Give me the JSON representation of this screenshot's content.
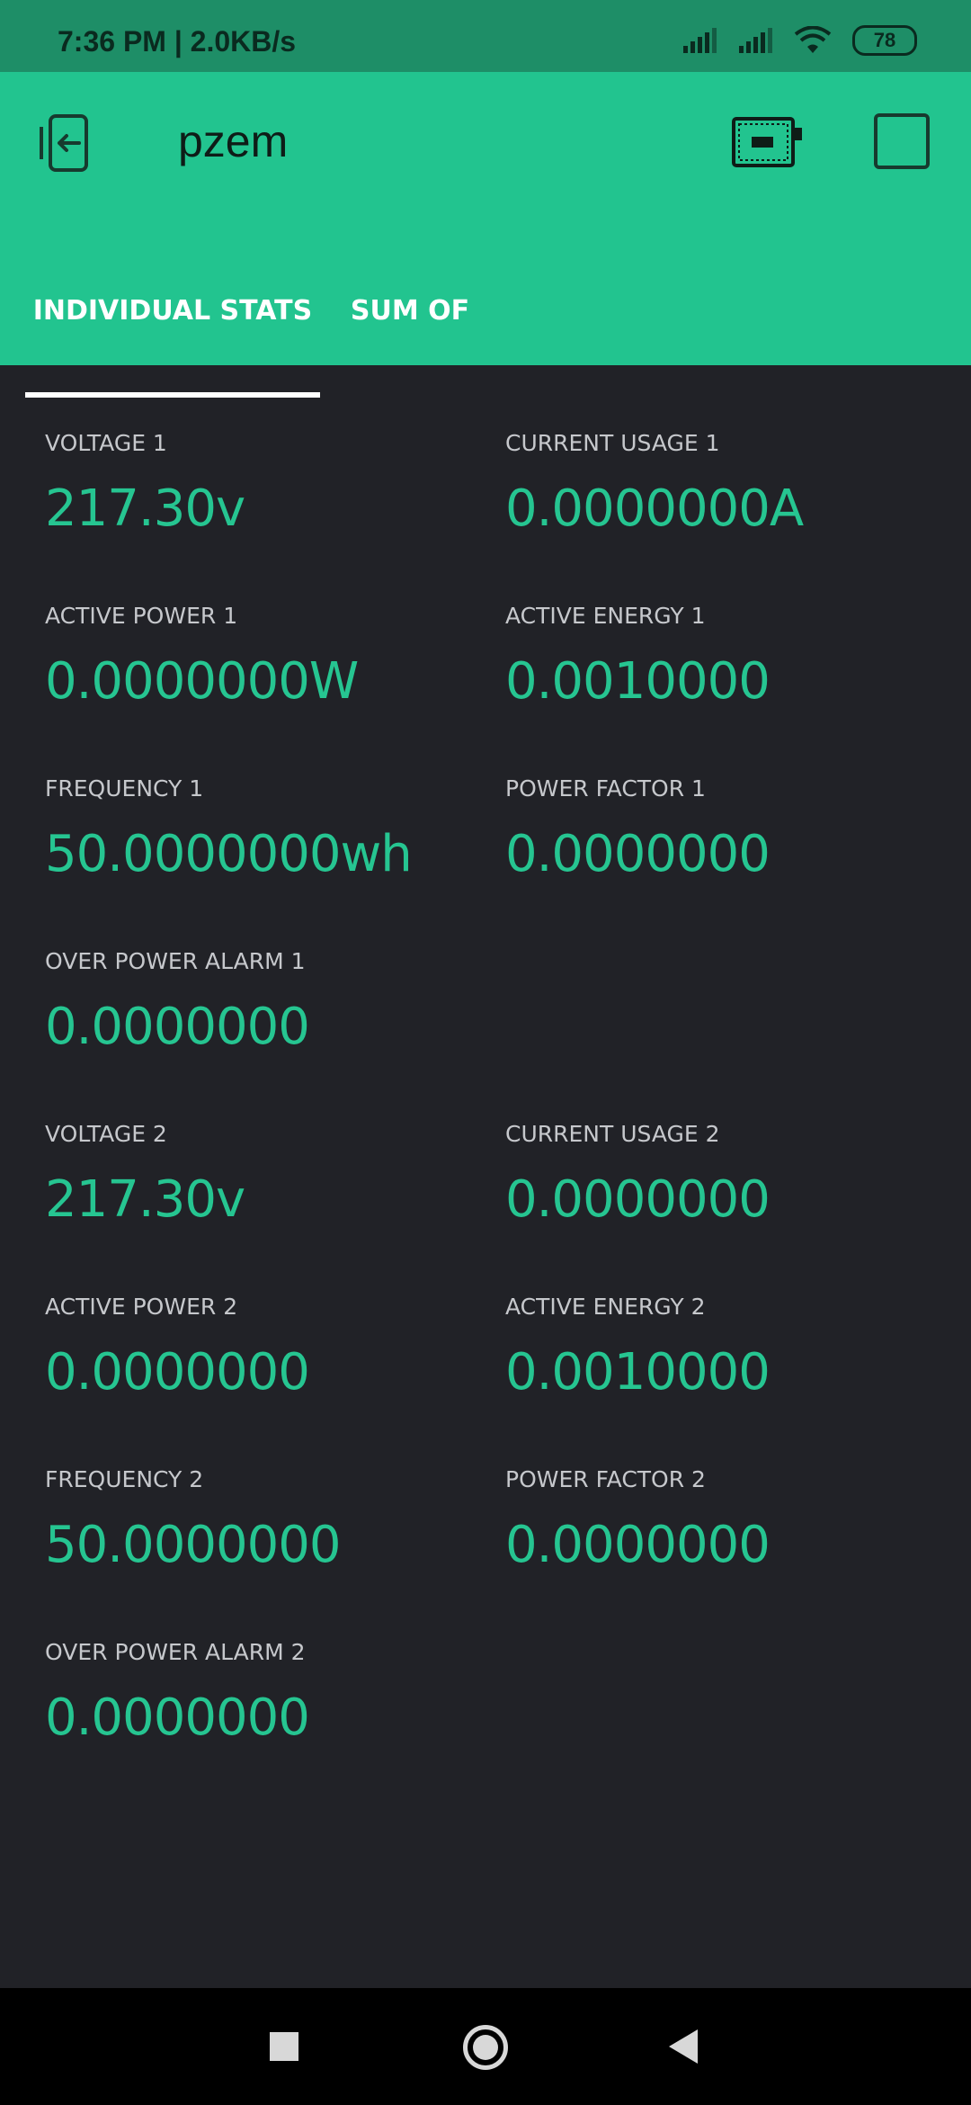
{
  "status_bar": {
    "time": "7:36 PM | 2.0KB/s",
    "battery": "78",
    "icons": [
      "signal-icon",
      "signal-icon",
      "wifi-icon",
      "battery-icon"
    ]
  },
  "app_bar": {
    "title": "pzem",
    "background_color": "#22c48f",
    "icons": [
      "back-icon",
      "device-icon",
      "square-icon"
    ]
  },
  "tabs": [
    {
      "label": "INDIVIDUAL STATS",
      "selected": true
    },
    {
      "label": "SUM OF",
      "selected": false
    }
  ],
  "stats": [
    {
      "label": "VOLTAGE 1",
      "value": "217.30v"
    },
    {
      "label": "CURRENT USAGE 1",
      "value": "0.0000000A"
    },
    {
      "label": "ACTIVE POWER 1",
      "value": "0.0000000W"
    },
    {
      "label": "ACTIVE ENERGY 1",
      "value": "0.0010000"
    },
    {
      "label": "FREQUENCY 1",
      "value": "50.0000000wh"
    },
    {
      "label": "POWER FACTOR 1",
      "value": "0.0000000"
    },
    {
      "label": "OVER POWER ALARM 1",
      "value": "0.0000000"
    },
    {
      "label": "VOLTAGE 2",
      "value": "217.30v"
    },
    {
      "label": "CURRENT USAGE 2",
      "value": "0.0000000"
    },
    {
      "label": "ACTIVE POWER 2",
      "value": "0.0000000"
    },
    {
      "label": "ACTIVE ENERGY 2",
      "value": "0.0010000"
    },
    {
      "label": "FREQUENCY 2",
      "value": "50.0000000"
    },
    {
      "label": "POWER FACTOR 2",
      "value": "0.0000000"
    },
    {
      "label": "OVER POWER ALARM 2",
      "value": "0.0000000"
    }
  ],
  "colors": {
    "accent": "#22c48f",
    "value_text": "#26c591",
    "background": "#212227"
  },
  "nav_bar": {
    "icons": [
      "recents-icon",
      "home-icon",
      "back-nav-icon"
    ]
  }
}
